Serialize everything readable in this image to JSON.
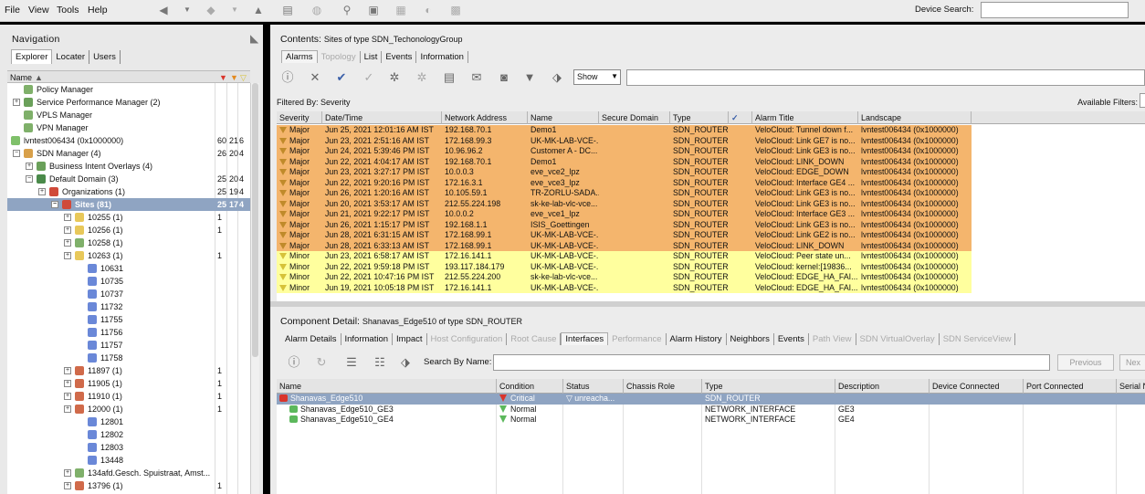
{
  "menu": {
    "file": "File",
    "view": "View",
    "tools": "Tools",
    "help": "Help"
  },
  "device_search": {
    "label": "Device Search:",
    "value": ""
  },
  "navigation": {
    "title": "Navigation",
    "tabs": [
      "Explorer",
      "Locater",
      "Users"
    ],
    "col_name": "Name",
    "tree": [
      {
        "label": "Policy Manager",
        "c1": "",
        "c2": "",
        "c3": ""
      },
      {
        "label": "Service Performance Manager  (2)",
        "c1": "",
        "c2": "",
        "c3": ""
      },
      {
        "label": "VPLS Manager",
        "c1": "",
        "c2": "",
        "c3": ""
      },
      {
        "label": "VPN Manager",
        "c1": "",
        "c2": "",
        "c3": ""
      },
      {
        "label": "lvntest006434 (0x1000000)",
        "c1": "60",
        "c2": "21",
        "c3": "6"
      },
      {
        "label": "SDN Manager  (4)",
        "c1": "26",
        "c2": "20",
        "c3": "4"
      },
      {
        "label": "Business Intent Overlays  (4)",
        "c1": "",
        "c2": "",
        "c3": ""
      },
      {
        "label": "Default Domain  (3)",
        "c1": "25",
        "c2": "20",
        "c3": "4"
      },
      {
        "label": "Organizations  (1)",
        "c1": "25",
        "c2": "19",
        "c3": "4"
      },
      {
        "label": "Sites  (81)",
        "c1": "25",
        "c2": "17",
        "c3": "4"
      },
      {
        "label": "10255  (1)",
        "c1": "1",
        "c2": "",
        "c3": ""
      },
      {
        "label": "10256  (1)",
        "c1": "1",
        "c2": "",
        "c3": ""
      },
      {
        "label": "10258  (1)",
        "c1": "",
        "c2": "",
        "c3": ""
      },
      {
        "label": "10263  (1)",
        "c1": "1",
        "c2": "",
        "c3": ""
      },
      {
        "label": "10631",
        "c1": "",
        "c2": "",
        "c3": ""
      },
      {
        "label": "10735",
        "c1": "",
        "c2": "",
        "c3": ""
      },
      {
        "label": "10737",
        "c1": "",
        "c2": "",
        "c3": ""
      },
      {
        "label": "11732",
        "c1": "",
        "c2": "",
        "c3": ""
      },
      {
        "label": "11755",
        "c1": "",
        "c2": "",
        "c3": ""
      },
      {
        "label": "11756",
        "c1": "",
        "c2": "",
        "c3": ""
      },
      {
        "label": "11757",
        "c1": "",
        "c2": "",
        "c3": ""
      },
      {
        "label": "11758",
        "c1": "",
        "c2": "",
        "c3": ""
      },
      {
        "label": "11897  (1)",
        "c1": "1",
        "c2": "",
        "c3": ""
      },
      {
        "label": "11905  (1)",
        "c1": "1",
        "c2": "",
        "c3": ""
      },
      {
        "label": "11910  (1)",
        "c1": "1",
        "c2": "",
        "c3": ""
      },
      {
        "label": "12000  (1)",
        "c1": "1",
        "c2": "",
        "c3": ""
      },
      {
        "label": "12801",
        "c1": "",
        "c2": "",
        "c3": ""
      },
      {
        "label": "12802",
        "c1": "",
        "c2": "",
        "c3": ""
      },
      {
        "label": "12803",
        "c1": "",
        "c2": "",
        "c3": ""
      },
      {
        "label": "13448",
        "c1": "",
        "c2": "",
        "c3": ""
      },
      {
        "label": "134afd.Gesch. Spuistraat, Amst...",
        "c1": "",
        "c2": "",
        "c3": ""
      },
      {
        "label": "13796  (1)",
        "c1": "1",
        "c2": "",
        "c3": ""
      }
    ]
  },
  "contents": {
    "prefix": "Contents:",
    "title": "Sites of type SDN_TechonologyGroup",
    "tabs": [
      "Alarms",
      "Topology",
      "List",
      "Events",
      "Information"
    ],
    "show_select": "Show",
    "filtered_by": "Filtered By: Severity",
    "available_filters": "Available Filters:",
    "columns": [
      "Severity",
      "Date/Time",
      "Network Address",
      "Name",
      "Secure Domain",
      "Type",
      "✓",
      "Alarm Title",
      "Landscape"
    ],
    "rows": [
      {
        "sev": "Major",
        "dt": "Jun 25, 2021 12:01:16 AM IST",
        "addr": "192.168.70.1",
        "name": "Demo1",
        "sd": "",
        "type": "SDN_ROUTER",
        "ack": "",
        "title": "VeloCloud: Tunnel down f...",
        "land": "lvntest006434 (0x1000000)"
      },
      {
        "sev": "Major",
        "dt": "Jun 23, 2021 2:51:16 AM IST",
        "addr": "172.168.99.3",
        "name": "UK-MK-LAB-VCE-...",
        "sd": "",
        "type": "SDN_ROUTER",
        "ack": "",
        "title": "VeloCloud: Link GE7 is no...",
        "land": "lvntest006434 (0x1000000)"
      },
      {
        "sev": "Major",
        "dt": "Jun 24, 2021 5:39:46 PM IST",
        "addr": "10.96.96.2",
        "name": "Customer A - DC...",
        "sd": "",
        "type": "SDN_ROUTER",
        "ack": "",
        "title": "VeloCloud: Link GE3 is no...",
        "land": "lvntest006434 (0x1000000)"
      },
      {
        "sev": "Major",
        "dt": "Jun 22, 2021 4:04:17 AM IST",
        "addr": "192.168.70.1",
        "name": "Demo1",
        "sd": "",
        "type": "SDN_ROUTER",
        "ack": "",
        "title": "VeloCloud: LINK_DOWN",
        "land": "lvntest006434 (0x1000000)"
      },
      {
        "sev": "Major",
        "dt": "Jun 23, 2021 3:27:17 PM IST",
        "addr": "10.0.0.3",
        "name": "eve_vce2_lpz",
        "sd": "",
        "type": "SDN_ROUTER",
        "ack": "",
        "title": "VeloCloud: EDGE_DOWN",
        "land": "lvntest006434 (0x1000000)"
      },
      {
        "sev": "Major",
        "dt": "Jun 22, 2021 9:20:16 PM IST",
        "addr": "172.16.3.1",
        "name": "eve_vce3_lpz",
        "sd": "",
        "type": "SDN_ROUTER",
        "ack": "",
        "title": "VeloCloud: Interface GE4 ...",
        "land": "lvntest006434 (0x1000000)"
      },
      {
        "sev": "Major",
        "dt": "Jun 26, 2021 1:20:16 AM IST",
        "addr": "10.105.59.1",
        "name": "TR-ZORLU-SADA...",
        "sd": "",
        "type": "SDN_ROUTER",
        "ack": "",
        "title": "VeloCloud: Link GE3 is no...",
        "land": "lvntest006434 (0x1000000)"
      },
      {
        "sev": "Major",
        "dt": "Jun 20, 2021 3:53:17 AM IST",
        "addr": "212.55.224.198",
        "name": "sk-ke-lab-vlc-vce...",
        "sd": "",
        "type": "SDN_ROUTER",
        "ack": "",
        "title": "VeloCloud: Link GE3 is no...",
        "land": "lvntest006434 (0x1000000)"
      },
      {
        "sev": "Major",
        "dt": "Jun 21, 2021 9:22:17 PM IST",
        "addr": "10.0.0.2",
        "name": "eve_vce1_lpz",
        "sd": "",
        "type": "SDN_ROUTER",
        "ack": "",
        "title": "VeloCloud: Interface GE3 ...",
        "land": "lvntest006434 (0x1000000)"
      },
      {
        "sev": "Major",
        "dt": "Jun 26, 2021 1:15:17 PM IST",
        "addr": "192.168.1.1",
        "name": "ISIS_Goettingen",
        "sd": "",
        "type": "SDN_ROUTER",
        "ack": "",
        "title": "VeloCloud: Link GE3 is no...",
        "land": "lvntest006434 (0x1000000)"
      },
      {
        "sev": "Major",
        "dt": "Jun 28, 2021 6:31:15 AM IST",
        "addr": "172.168.99.1",
        "name": "UK-MK-LAB-VCE-...",
        "sd": "",
        "type": "SDN_ROUTER",
        "ack": "",
        "title": "VeloCloud: Link GE2 is no...",
        "land": "lvntest006434 (0x1000000)"
      },
      {
        "sev": "Major",
        "dt": "Jun 28, 2021 6:33:13 AM IST",
        "addr": "172.168.99.1",
        "name": "UK-MK-LAB-VCE-...",
        "sd": "",
        "type": "SDN_ROUTER",
        "ack": "",
        "title": "VeloCloud: LINK_DOWN",
        "land": "lvntest006434 (0x1000000)"
      },
      {
        "sev": "Minor",
        "dt": "Jun 23, 2021 6:58:17 AM IST",
        "addr": "172.16.141.1",
        "name": "UK-MK-LAB-VCE-...",
        "sd": "",
        "type": "SDN_ROUTER",
        "ack": "",
        "title": "VeloCloud: Peer state un...",
        "land": "lvntest006434 (0x1000000)"
      },
      {
        "sev": "Minor",
        "dt": "Jun 22, 2021 9:59:18 PM IST",
        "addr": "193.117.184.179",
        "name": "UK-MK-LAB-VCE-...",
        "sd": "",
        "type": "SDN_ROUTER",
        "ack": "",
        "title": "VeloCloud: kernel:[19836...",
        "land": "lvntest006434 (0x1000000)"
      },
      {
        "sev": "Minor",
        "dt": "Jun 22, 2021 10:47:16 PM IST",
        "addr": "212.55.224.200",
        "name": "sk-ke-lab-vlc-vce...",
        "sd": "",
        "type": "SDN_ROUTER",
        "ack": "",
        "title": "VeloCloud: EDGE_HA_FAI...",
        "land": "lvntest006434 (0x1000000)"
      },
      {
        "sev": "Minor",
        "dt": "Jun 19, 2021 10:05:18 PM IST",
        "addr": "172.16.141.1",
        "name": "UK-MK-LAB-VCE-...",
        "sd": "",
        "type": "SDN_ROUTER",
        "ack": "",
        "title": "VeloCloud: EDGE_HA_FAI...",
        "land": "lvntest006434 (0x1000000)"
      }
    ]
  },
  "component": {
    "prefix": "Component Detail:",
    "title": "Shanavas_Edge510 of type SDN_ROUTER",
    "tabs": [
      "Alarm Details",
      "Information",
      "Impact",
      "Host Configuration",
      "Root Cause",
      "Interfaces",
      "Performance",
      "Alarm History",
      "Neighbors",
      "Events",
      "Path View",
      "SDN VirtualOverlay",
      "SDN ServiceView"
    ],
    "search_label": "Search By Name:",
    "previous": "Previous",
    "next": "Nex",
    "columns": [
      "Name",
      "Condition",
      "Status",
      "Chassis Role",
      "Type",
      "Description",
      "Device Connected",
      "Port Connected",
      "Serial N"
    ],
    "rows": [
      {
        "name": "Shanavas_Edge510",
        "cond": "Critical",
        "status": "unreacha...",
        "role": "",
        "type": "SDN_ROUTER",
        "desc": "",
        "dev": "",
        "port": "",
        "serial": ""
      },
      {
        "name": "Shanavas_Edge510_GE3",
        "cond": "Normal",
        "status": "",
        "role": "",
        "type": "NETWORK_INTERFACE",
        "desc": "GE3",
        "dev": "",
        "port": "",
        "serial": ""
      },
      {
        "name": "Shanavas_Edge510_GE4",
        "cond": "Normal",
        "status": "",
        "role": "",
        "type": "NETWORK_INTERFACE",
        "desc": "GE4",
        "dev": "",
        "port": "",
        "serial": ""
      }
    ]
  },
  "colors": {
    "major": "#f4b56d",
    "minor": "#ffff9e",
    "selection": "#8fa4c2",
    "critical": "#d9342b",
    "normal": "#5cb85c"
  }
}
